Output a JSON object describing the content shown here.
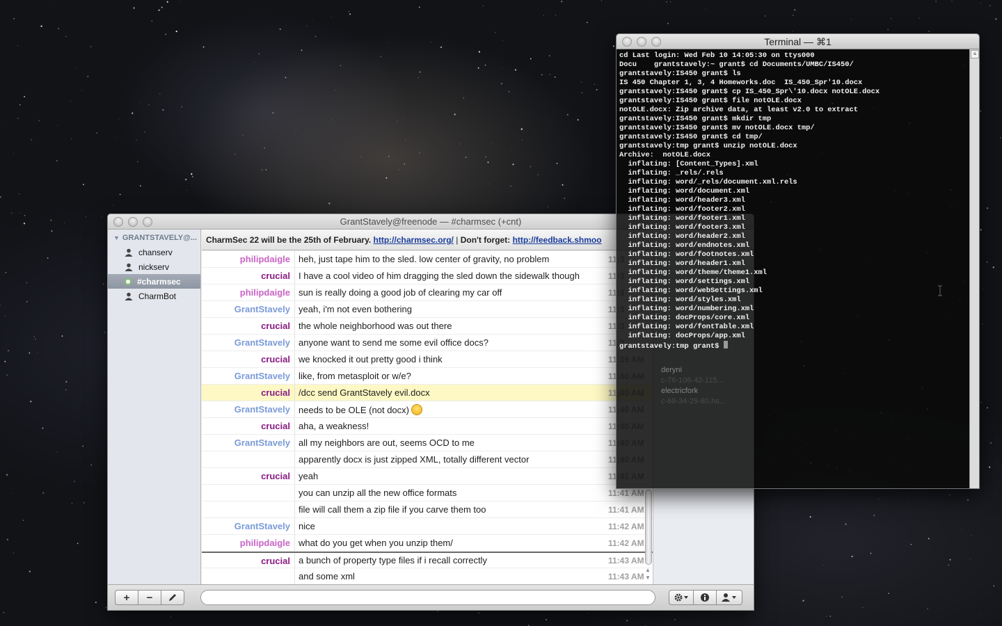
{
  "chat_window": {
    "title": "GrantStavely@freenode — #charmsec (+cnt)",
    "server": "GRANTSTAVELY@...",
    "sidebar_items": [
      {
        "label": "chanserv",
        "type": "user"
      },
      {
        "label": "nickserv",
        "type": "user"
      },
      {
        "label": "#charmsec",
        "type": "channel",
        "selected": true
      },
      {
        "label": "CharmBot",
        "type": "user"
      }
    ],
    "topic": {
      "text1": "CharmSec 22 will be the 25th of February.",
      "link1": "http://charmsec.org/",
      "sep": "|",
      "text2": "Don't forget:",
      "link2": "http://feedback.shmoo"
    },
    "messages": [
      {
        "nick": "philipdaigle",
        "color": "philip",
        "text": "heh, just tape him to the sled.  low center of gravity, no problem",
        "time": "11:3"
      },
      {
        "nick": "crucial",
        "color": "crucial",
        "text": "I have a cool video of him dragging the sled down the sidewalk though",
        "time": "11:3"
      },
      {
        "nick": "philipdaigle",
        "color": "philip",
        "text": "sun is really doing a good job of clearing my car off",
        "time": "11:3"
      },
      {
        "nick": "GrantStavely",
        "color": "grant",
        "text": "yeah, i'm not even bothering",
        "time": "11:3"
      },
      {
        "nick": "crucial",
        "color": "crucial",
        "text": "the whole neighborhood was out there",
        "time": "11:3"
      },
      {
        "nick": "GrantStavely",
        "color": "grant",
        "text": "anyone want to send me some evil office docs?",
        "time": "11:3"
      },
      {
        "nick": "crucial",
        "color": "crucial",
        "text": "we knocked it out pretty good i think",
        "time": "11:39 AM"
      },
      {
        "nick": "GrantStavely",
        "color": "grant",
        "text": "like, from metasploit or w/e?",
        "time": "11:40 AM"
      },
      {
        "nick": "crucial",
        "color": "crucial",
        "text": "/dcc send GrantStavely evil.docx",
        "time": "11:40 AM",
        "highlight": true
      },
      {
        "nick": "GrantStavely",
        "color": "grant",
        "text": "needs to be OLE (not docx)",
        "time": "11:40 AM",
        "smiley": true
      },
      {
        "nick": "crucial",
        "color": "crucial",
        "text": "aha, a weakness!",
        "time": "11:40 AM"
      },
      {
        "nick": "GrantStavely",
        "color": "grant",
        "text": "all my neighbors are out, seems OCD to me",
        "time": "11:40 AM"
      },
      {
        "nick": "",
        "color": "grant",
        "text": "apparently docx is just zipped XML, totally different vector",
        "time": "11:40 AM"
      },
      {
        "nick": "crucial",
        "color": "crucial",
        "text": "yeah",
        "time": "11:41 AM"
      },
      {
        "nick": "",
        "color": "crucial",
        "text": "you can unzip all the new office formats",
        "time": "11:41 AM"
      },
      {
        "nick": "",
        "color": "crucial",
        "text": "file will call them a zip file if you carve them too",
        "time": "11:41 AM"
      },
      {
        "nick": "GrantStavely",
        "color": "grant",
        "text": "nice",
        "time": "11:42 AM"
      },
      {
        "nick": "philipdaigle",
        "color": "philip",
        "text": "what do you get when you unzip them/",
        "time": "11:42 AM"
      },
      {
        "nick": "crucial",
        "color": "crucial",
        "text": "a bunch of property type files if i recall correctly",
        "time": "11:43 AM",
        "marker": true
      },
      {
        "nick": "",
        "color": "crucial",
        "text": "and some xml",
        "time": "11:43 AM"
      }
    ],
    "bottom": {
      "add": "+",
      "remove": "−",
      "input_value": "",
      "input_placeholder": ""
    },
    "ghost_members": [
      {
        "name": "deryni",
        "host": "c-76-106-42-115..."
      },
      {
        "name": "electricfork",
        "host": "c-68-34-29-80.hs..."
      }
    ]
  },
  "terminal": {
    "title": "Terminal — ⌘1",
    "lines": [
      "cd Last login: Wed Feb 10 14:05:30 on ttys000",
      "Docu    grantstavely:~ grant$ cd Documents/UMBC/IS450/",
      "grantstavely:IS450 grant$ ls",
      "IS 450 Chapter 1, 3, 4 Homeworks.doc  IS_450_Spr'10.docx",
      "grantstavely:IS450 grant$ cp IS_450_Spr\\'10.docx notOLE.docx",
      "grantstavely:IS450 grant$ file notOLE.docx",
      "notOLE.docx: Zip archive data, at least v2.0 to extract",
      "grantstavely:IS450 grant$ mkdir tmp",
      "grantstavely:IS450 grant$ mv notOLE.docx tmp/",
      "grantstavely:IS450 grant$ cd tmp/",
      "grantstavely:tmp grant$ unzip notOLE.docx",
      "Archive:  notOLE.docx",
      "  inflating: [Content_Types].xml",
      "  inflating: _rels/.rels",
      "  inflating: word/_rels/document.xml.rels",
      "  inflating: word/document.xml",
      "  inflating: word/header3.xml",
      "  inflating: word/footer2.xml",
      "  inflating: word/footer1.xml",
      "  inflating: word/footer3.xml",
      "  inflating: word/header2.xml",
      "  inflating: word/endnotes.xml",
      "  inflating: word/footnotes.xml",
      "  inflating: word/header1.xml",
      "  inflating: word/theme/theme1.xml",
      "  inflating: word/settings.xml",
      "  inflating: word/webSettings.xml",
      "  inflating: word/styles.xml",
      "  inflating: word/numbering.xml",
      "  inflating: docProps/core.xml",
      "  inflating: word/fontTable.xml",
      "  inflating: docProps/app.xml"
    ],
    "prompt": "grantstavely:tmp grant$ "
  }
}
